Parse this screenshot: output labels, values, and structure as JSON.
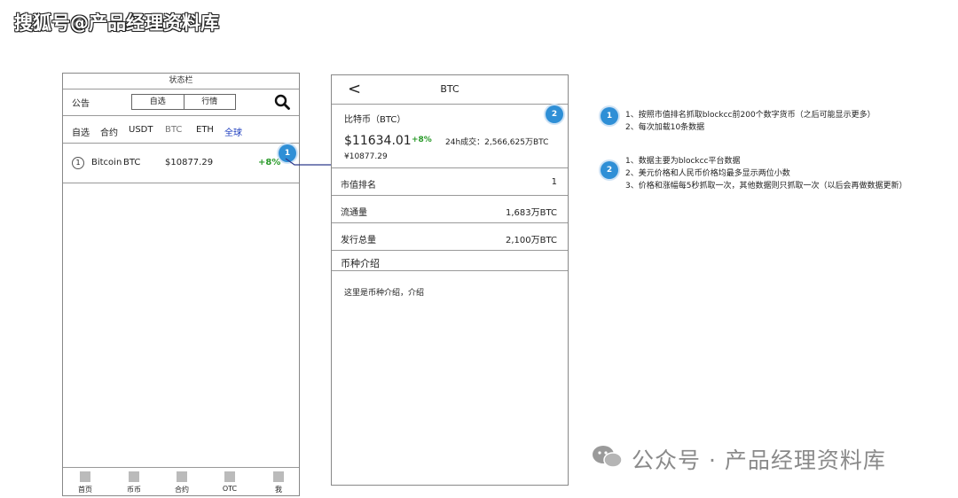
{
  "watermark_top": "搜狐号@产品经理资料库",
  "watermark_bottom": "公众号 · 产品经理资料库",
  "left_phone": {
    "status_bar": "状态栏",
    "notice": "公告",
    "segment": [
      "自选",
      "行情"
    ],
    "tabs": [
      "自选",
      "合约",
      "USDT",
      "BTC",
      "ETH",
      "全球"
    ],
    "list_row": {
      "index": "1",
      "name": "Bitcoin",
      "symbol": "BTC",
      "price": "$10877.29",
      "change": "+8%"
    },
    "badge": "1",
    "bottom_nav": [
      "首页",
      "币币",
      "合约",
      "OTC",
      "我"
    ]
  },
  "right_phone": {
    "back": "<",
    "title": "BTC",
    "coin_name": "比特币（BTC）",
    "badge": "2",
    "price_usd": "$11634.01",
    "change": "+8%",
    "volume": "24h成交：2,566,625万BTC",
    "price_cny": "¥10877.29",
    "rows": [
      {
        "label": "市值排名",
        "value": "1"
      },
      {
        "label": "流通量",
        "value": "1,683万BTC"
      },
      {
        "label": "发行总量",
        "value": "2,100万BTC"
      }
    ],
    "section_title": "币种介绍",
    "intro": "这里是币种介绍，介绍"
  },
  "notes": [
    {
      "badge": "1",
      "lines": [
        "1、按照市值排名抓取blockcc前200个数字货币（之后可能显示更多）",
        "2、每次加载10条数据"
      ]
    },
    {
      "badge": "2",
      "lines": [
        "1、数据主要为blockcc平台数据",
        "2、美元价格和人民币价格均最多显示两位小数",
        "3、价格和涨幅每5秒抓取一次，其他数据则只抓取一次（以后会再做数据更新）"
      ]
    }
  ],
  "colors": {
    "positive": "#2a9a2a",
    "active_tab": "#1f3fbf",
    "badge": "#2f8fd6",
    "arrow": "#2d3a8c"
  }
}
